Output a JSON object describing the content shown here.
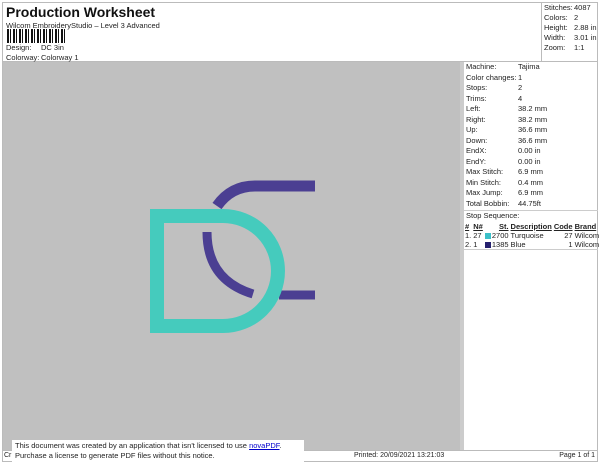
{
  "header": {
    "title": "Production Worksheet",
    "subtitle": "Wilcom EmbroideryStudio – Level 3 Advanced",
    "design_label": "Design:",
    "design": "DC 3in",
    "colorway_label": "Colorway:",
    "colorway": "Colorway 1"
  },
  "stats": [
    {
      "k": "Stitches:",
      "v": "4087"
    },
    {
      "k": "Colors:",
      "v": "2"
    },
    {
      "k": "Height:",
      "v": "2.88 in"
    },
    {
      "k": "Width:",
      "v": "3.01 in"
    },
    {
      "k": "Zoom:",
      "v": "1:1"
    }
  ],
  "props": [
    {
      "k": "Machine:",
      "v": "Tajima"
    },
    {
      "k": "Color changes:",
      "v": "1"
    },
    {
      "k": "Stops:",
      "v": "2"
    },
    {
      "k": "Trims:",
      "v": "4"
    },
    {
      "k": "Left:",
      "v": "38.2 mm"
    },
    {
      "k": "Right:",
      "v": "38.2 mm"
    },
    {
      "k": "Up:",
      "v": "36.6 mm"
    },
    {
      "k": "Down:",
      "v": "36.6 mm"
    },
    {
      "k": "EndX:",
      "v": "0.00 in"
    },
    {
      "k": "EndY:",
      "v": "0.00 in"
    },
    {
      "k": "Max Stitch:",
      "v": "6.9 mm"
    },
    {
      "k": "Min Stitch:",
      "v": "0.4 mm"
    },
    {
      "k": "Max Jump:",
      "v": "6.9 mm"
    },
    {
      "k": "Total Bobbin:",
      "v": "44.75ft"
    }
  ],
  "stop_sequence": {
    "title": "Stop Sequence:",
    "headers": [
      "#",
      "N#",
      "St.",
      "Description",
      "Code",
      "Brand"
    ],
    "rows": [
      {
        "n": "1.",
        "num": "27",
        "color": "#3cc0c8",
        "st": "2700",
        "desc": "Turquoise",
        "code": "27",
        "brand": "Wilcom"
      },
      {
        "n": "2.",
        "num": "1",
        "color": "#25206e",
        "st": "1385",
        "desc": "Blue",
        "code": "1",
        "brand": "Wilcom"
      }
    ]
  },
  "colors": {
    "turquoise": "#45cbbd",
    "blue": "#4b3f92",
    "canvas": "#c0c0c0"
  },
  "footer": {
    "left": "Cr",
    "printed": "Printed: 20/09/2021 13:21:03",
    "page": "Page 1 of 1"
  },
  "notice": {
    "line1": "This document was created by an application that isn't licensed to use ",
    "link": "novaPDF",
    "line1_end": ".",
    "line2": "Purchase a license to generate PDF files without this notice."
  }
}
